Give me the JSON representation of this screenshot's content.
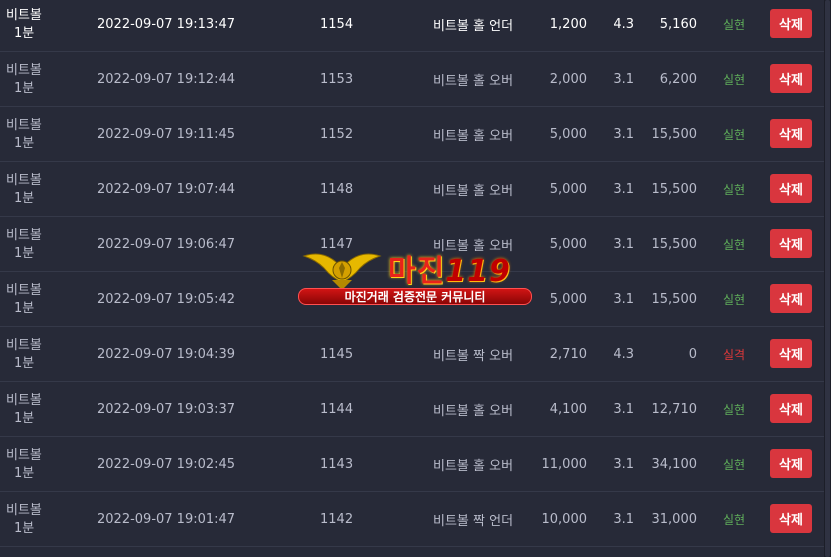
{
  "bets": [
    {
      "game_line1": "비트볼",
      "game_line2": "1분",
      "time": "2022-09-07 19:13:47",
      "round": "1154",
      "pick": "비트볼 홀 언더",
      "amount": "1,200",
      "odds": "4.3",
      "payout": "5,160",
      "status": "실현",
      "action": "삭제"
    },
    {
      "game_line1": "비트볼",
      "game_line2": "1분",
      "time": "2022-09-07 19:12:44",
      "round": "1153",
      "pick": "비트볼 홀 오버",
      "amount": "2,000",
      "odds": "3.1",
      "payout": "6,200",
      "status": "실현",
      "action": "삭제"
    },
    {
      "game_line1": "비트볼",
      "game_line2": "1분",
      "time": "2022-09-07 19:11:45",
      "round": "1152",
      "pick": "비트볼 홀 오버",
      "amount": "5,000",
      "odds": "3.1",
      "payout": "15,500",
      "status": "실현",
      "action": "삭제"
    },
    {
      "game_line1": "비트볼",
      "game_line2": "1분",
      "time": "2022-09-07 19:07:44",
      "round": "1148",
      "pick": "비트볼 홀 오버",
      "amount": "5,000",
      "odds": "3.1",
      "payout": "15,500",
      "status": "실현",
      "action": "삭제"
    },
    {
      "game_line1": "비트볼",
      "game_line2": "1분",
      "time": "2022-09-07 19:06:47",
      "round": "1147",
      "pick": "비트볼 홀 오버",
      "amount": "5,000",
      "odds": "3.1",
      "payout": "15,500",
      "status": "실현",
      "action": "삭제"
    },
    {
      "game_line1": "비트볼",
      "game_line2": "1분",
      "time": "2022-09-07 19:05:42",
      "round": "",
      "pick": "",
      "amount": "5,000",
      "odds": "3.1",
      "payout": "15,500",
      "status": "실현",
      "action": "삭제"
    },
    {
      "game_line1": "비트볼",
      "game_line2": "1분",
      "time": "2022-09-07 19:04:39",
      "round": "1145",
      "pick": "비트볼 짝 오버",
      "amount": "2,710",
      "odds": "4.3",
      "payout": "0",
      "status": "실격",
      "action": "삭제"
    },
    {
      "game_line1": "비트볼",
      "game_line2": "1분",
      "time": "2022-09-07 19:03:37",
      "round": "1144",
      "pick": "비트볼 홀 오버",
      "amount": "4,100",
      "odds": "3.1",
      "payout": "12,710",
      "status": "실현",
      "action": "삭제"
    },
    {
      "game_line1": "비트볼",
      "game_line2": "1분",
      "time": "2022-09-07 19:02:45",
      "round": "1143",
      "pick": "비트볼 홀 오버",
      "amount": "11,000",
      "odds": "3.1",
      "payout": "34,100",
      "status": "실현",
      "action": "삭제"
    },
    {
      "game_line1": "비트볼",
      "game_line2": "1분",
      "time": "2022-09-07 19:01:47",
      "round": "1142",
      "pick": "비트볼 짝 언더",
      "amount": "10,000",
      "odds": "3.1",
      "payout": "31,000",
      "status": "실현",
      "action": "삭제"
    }
  ],
  "watermark": {
    "title": "마진",
    "number": "119",
    "tagline": "마진거래 검증전문 커뮤니티"
  },
  "colors": {
    "background": "#272a38",
    "win": "#5fae5a",
    "lose": "#e0383a",
    "delete_button": "#d9363e"
  }
}
